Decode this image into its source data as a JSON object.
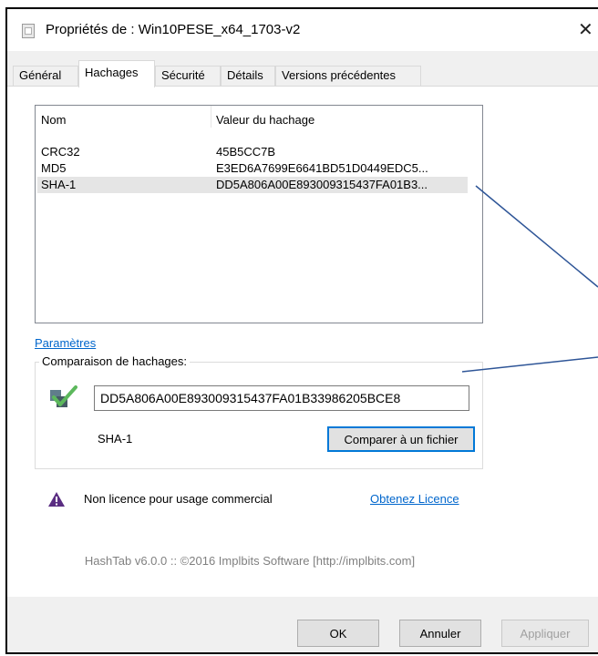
{
  "window": {
    "title": "Propriétés de : Win10PESE_x64_1703-v2",
    "close_glyph": "✕"
  },
  "tabs": [
    {
      "label": "Général",
      "active": false
    },
    {
      "label": "Hachages",
      "active": true
    },
    {
      "label": "Sécurité",
      "active": false
    },
    {
      "label": "Détails",
      "active": false
    },
    {
      "label": "Versions précédentes",
      "active": false
    }
  ],
  "hash_list": {
    "columns": [
      "Nom",
      "Valeur du hachage"
    ],
    "rows": [
      {
        "name": "CRC32",
        "value": "45B5CC7B",
        "selected": false
      },
      {
        "name": "MD5",
        "value": "E3ED6A7699E6641BD51D0449EDC5...",
        "selected": false
      },
      {
        "name": "SHA-1",
        "value": "DD5A806A00E893009315437FA01B3...",
        "selected": true
      }
    ]
  },
  "settings_link": "Paramètres",
  "comparison": {
    "group_label": "Comparaison de hachages:",
    "input_value": "DD5A806A00E893009315437FA01B33986205BCE8",
    "algorithm": "SHA-1",
    "compare_button": "Comparer à un fichier",
    "icon": "hash-match-check-icon",
    "match_color": "#5cb85c"
  },
  "license": {
    "text": "Non licence pour usage commercial",
    "link": "Obtenez Licence",
    "icon": "warning-triangle-icon",
    "icon_color": "#5a2d82"
  },
  "footer": "HashTab v6.0.0 :: ©2016 Implbits Software [http://implbits.com]",
  "buttons": {
    "ok": "OK",
    "cancel": "Annuler",
    "apply": "Appliquer"
  },
  "colors": {
    "link": "#0066cc",
    "focus": "#0078d7",
    "annotation_arrow": "#2e5597"
  }
}
